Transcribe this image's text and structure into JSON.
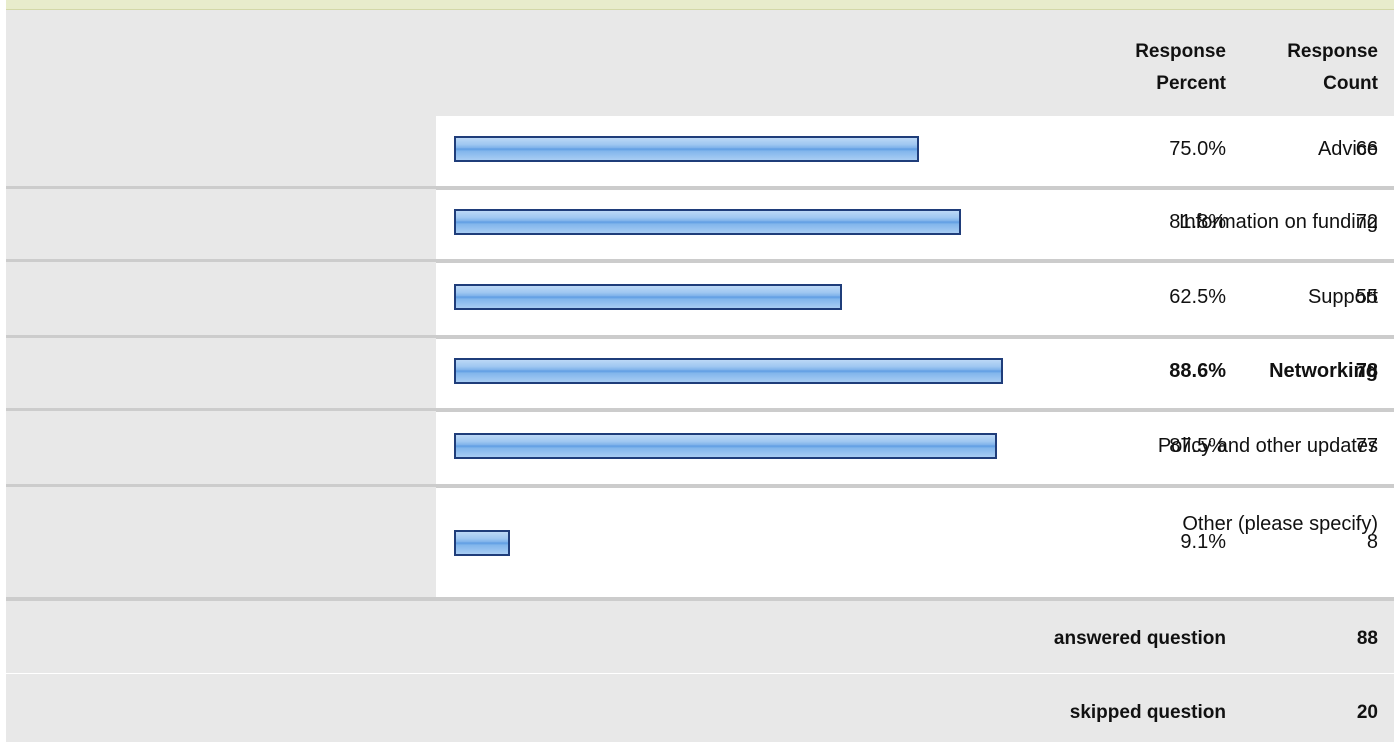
{
  "header": {
    "percent_label_line1": "Response",
    "percent_label_line2": "Percent",
    "count_label_line1": "Response",
    "count_label_line2": "Count"
  },
  "chart_data": {
    "type": "bar",
    "orientation": "horizontal",
    "categories": [
      "Advice",
      "Information on funding",
      "Support",
      "Networking",
      "Policy and other updates",
      "Other (please specify)"
    ],
    "values": [
      75.0,
      81.8,
      62.5,
      88.6,
      87.5,
      9.1
    ],
    "percent_labels": [
      "75.0%",
      "81.8%",
      "62.5%",
      "88.6%",
      "87.5%",
      "9.1%"
    ],
    "counts": [
      66,
      72,
      55,
      78,
      77,
      8
    ],
    "highlight_index": 3,
    "xlim": [
      0,
      100
    ],
    "colors": {
      "bar_fill": "#7fb2ea",
      "bar_border": "#1f3d7a",
      "label_bg": "#e8e8e8"
    }
  },
  "footer": {
    "answered_label": "answered question",
    "answered_value": "88",
    "skipped_label": "skipped question",
    "skipped_value": "20"
  }
}
